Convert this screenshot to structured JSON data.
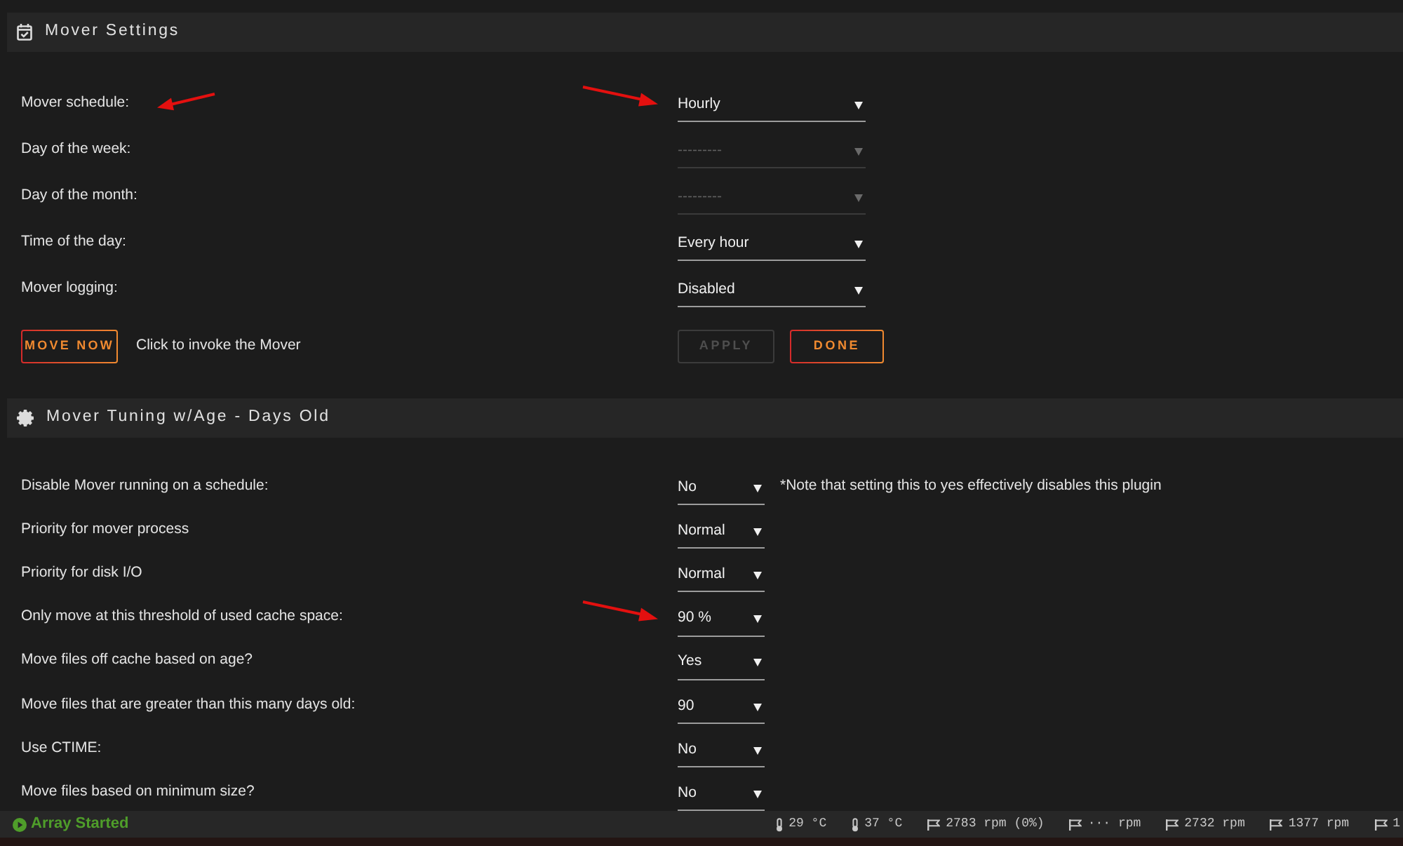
{
  "sections": [
    {
      "kind": "schedule",
      "title": "Mover Settings",
      "rows": [
        {
          "label": "Mover schedule:",
          "value": "Hourly",
          "disabled": false,
          "label_arrow": true,
          "value_arrow": true
        },
        {
          "label": "Day of the week:",
          "value": "---------",
          "disabled": true,
          "label_arrow": false,
          "value_arrow": false
        },
        {
          "label": "Day of the month:",
          "value": "---------",
          "disabled": true,
          "label_arrow": false,
          "value_arrow": false
        },
        {
          "label": "Time of the day:",
          "value": "Every hour",
          "disabled": false,
          "label_arrow": false,
          "value_arrow": false
        },
        {
          "label": "Mover logging:",
          "value": "Disabled",
          "disabled": false,
          "label_arrow": false,
          "value_arrow": false
        }
      ],
      "actions": {
        "move_button": "MOVE NOW",
        "hint": "Click to invoke the Mover",
        "buttons": [
          {
            "label": "APPLY",
            "disabled": true
          },
          {
            "label": "DONE",
            "disabled": false
          }
        ]
      }
    },
    {
      "kind": "tuning",
      "title": "Mover Tuning w/Age - Days Old",
      "rows": [
        {
          "label": "Disable Mover running on a schedule:",
          "value": "No",
          "disabled": false,
          "label_arrow": false,
          "value_arrow": false,
          "note": "*Note that setting this to yes effectively disables this plugin"
        },
        {
          "label": "Priority for mover process",
          "value": "Normal",
          "disabled": false,
          "label_arrow": false,
          "value_arrow": false
        },
        {
          "label": "Priority for disk I/O",
          "value": "Normal",
          "disabled": false,
          "label_arrow": false,
          "value_arrow": false
        },
        {
          "label": "Only move at this threshold of used cache space:",
          "value": "90 %",
          "disabled": false,
          "label_arrow": false,
          "value_arrow": true
        },
        {
          "label": "Move files off cache based on age?",
          "value": "Yes",
          "disabled": false,
          "label_arrow": false,
          "value_arrow": false
        },
        {
          "label": "Move files that are greater than this many days old:",
          "value": "90",
          "disabled": false,
          "label_arrow": false,
          "value_arrow": false
        },
        {
          "label": "Use CTIME:",
          "value": "No",
          "disabled": false,
          "label_arrow": false,
          "value_arrow": false
        },
        {
          "label": "Move files based on minimum size?",
          "value": "No",
          "disabled": false,
          "label_arrow": false,
          "value_arrow": false
        }
      ]
    }
  ],
  "status_bar": {
    "array": {
      "text": "Array Started",
      "started": true
    },
    "sensors": [
      {
        "kind": "temp",
        "reading": "29 °C"
      },
      {
        "kind": "temp",
        "reading": "37 °C"
      },
      {
        "kind": "fan",
        "reading": "2783 rpm (0%)"
      },
      {
        "kind": "fan",
        "reading": "··· rpm"
      },
      {
        "kind": "fan",
        "reading": "2732 rpm"
      },
      {
        "kind": "fan",
        "reading": "1377 rpm"
      },
      {
        "kind": "fan",
        "reading": "1"
      }
    ]
  }
}
